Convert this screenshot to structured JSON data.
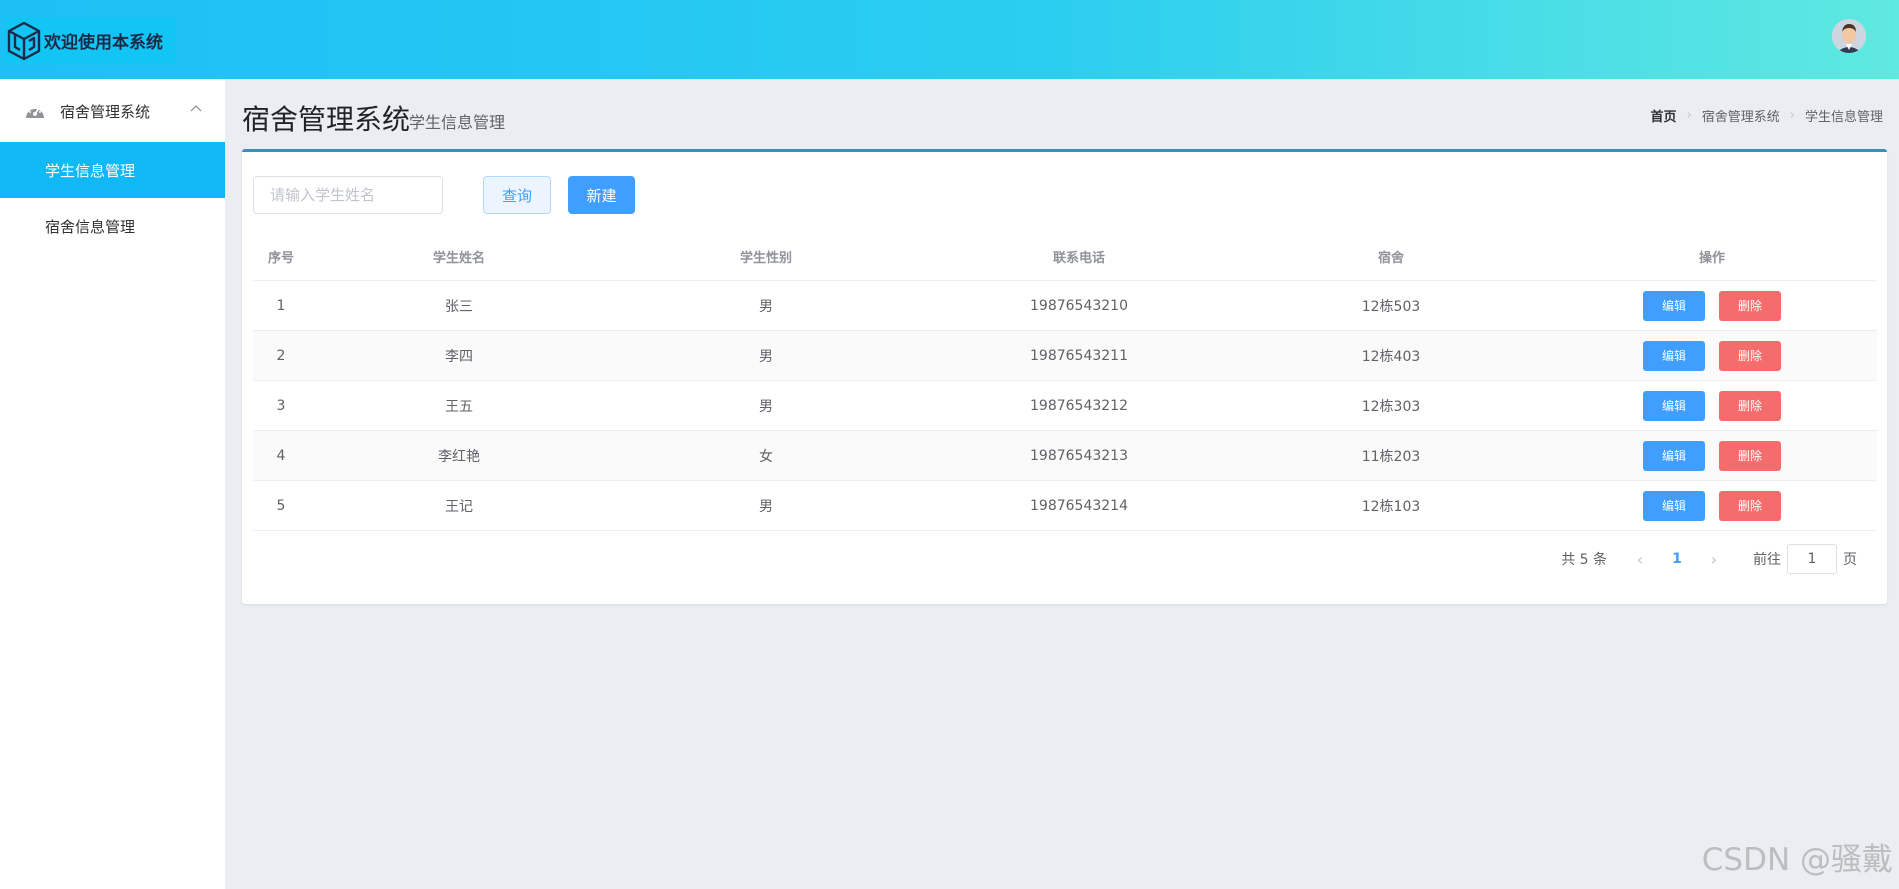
{
  "header": {
    "logo_text": "欢迎使用本系统",
    "icons": {
      "logo": "cube-logo-icon",
      "avatar": "user-avatar"
    }
  },
  "sidebar": {
    "group_label": "宿舍管理系统",
    "group_icon": "dashboard-gauge-icon",
    "items": [
      {
        "label": "学生信息管理",
        "active": true
      },
      {
        "label": "宿舍信息管理",
        "active": false
      }
    ]
  },
  "page": {
    "title": "宿舍管理系统",
    "subtitle": "学生信息管理"
  },
  "breadcrumb": [
    "首页",
    "宿舍管理系统",
    "学生信息管理"
  ],
  "toolbar": {
    "search_placeholder": "请输入学生姓名",
    "query_label": "查询",
    "new_label": "新建"
  },
  "table": {
    "headers": [
      "序号",
      "学生姓名",
      "学生性别",
      "联系电话",
      "宿舍",
      "操作"
    ],
    "edit_label": "编辑",
    "delete_label": "删除",
    "rows": [
      [
        "1",
        "张三",
        "男",
        "19876543210",
        "12栋503"
      ],
      [
        "2",
        "李四",
        "男",
        "19876543211",
        "12栋403"
      ],
      [
        "3",
        "王五",
        "男",
        "19876543212",
        "12栋303"
      ],
      [
        "4",
        "李红艳",
        "女",
        "19876543213",
        "11栋203"
      ],
      [
        "5",
        "王记",
        "男",
        "19876543214",
        "12栋103"
      ]
    ]
  },
  "pagination": {
    "total_text": "共 5 条",
    "current_page": "1",
    "goto_label": "前往",
    "goto_value": "1",
    "page_suffix": "页"
  },
  "watermark": "CSDN @骚戴",
  "colors": {
    "header_gradient_start": "#1cc0f5",
    "header_gradient_end": "#5fe9e0",
    "sidebar_active": "#10b8f5",
    "primary": "#409eff",
    "danger": "#f56c6c",
    "panel_accent": "#3c8dbc"
  }
}
